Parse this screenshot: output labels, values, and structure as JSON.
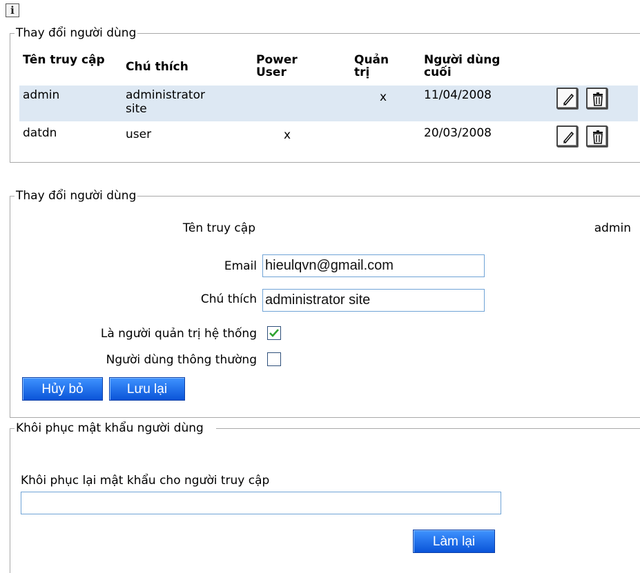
{
  "info_icon": "i",
  "user_list": {
    "legend": "Thay đổi người dùng",
    "columns": [
      "Tên truy cập",
      "Chú thích",
      "Power User",
      "Quản trị",
      "Người dùng cuối"
    ],
    "rows": [
      {
        "username": "admin",
        "note": "administrator site",
        "power_user": "",
        "admin": "x",
        "last_login": "11/04/2008"
      },
      {
        "username": "datdn",
        "note": "user",
        "power_user": "x",
        "admin": "",
        "last_login": "20/03/2008"
      }
    ]
  },
  "edit_user": {
    "legend": "Thay đổi người dùng",
    "username_label": "Tên truy cập",
    "username_value": "admin",
    "email_label": "Email",
    "email_value": "hieulqvn@gmail.com",
    "note_label": "Chú thích",
    "note_value": "administrator site",
    "is_admin_label": "Là người quản trị hệ thống",
    "is_admin_checked": true,
    "is_normal_label": "Người dùng thông thường",
    "is_normal_checked": false,
    "cancel_label": "Hủy bỏ",
    "save_label": "Lưu lại"
  },
  "reset_password": {
    "legend": "Khôi phục mật khẩu người dùng",
    "field_label": "Khôi phục lại mật khẩu cho người truy cập",
    "field_value": "",
    "reset_label": "Làm lại"
  },
  "icons": {
    "edit": "pencil-icon",
    "delete": "trash-icon",
    "info": "info-icon"
  },
  "colors": {
    "selected_row": "#dde8f3",
    "button": "#1a66e6",
    "input_border": "#6fa3d6",
    "check": "#2fa32f"
  }
}
